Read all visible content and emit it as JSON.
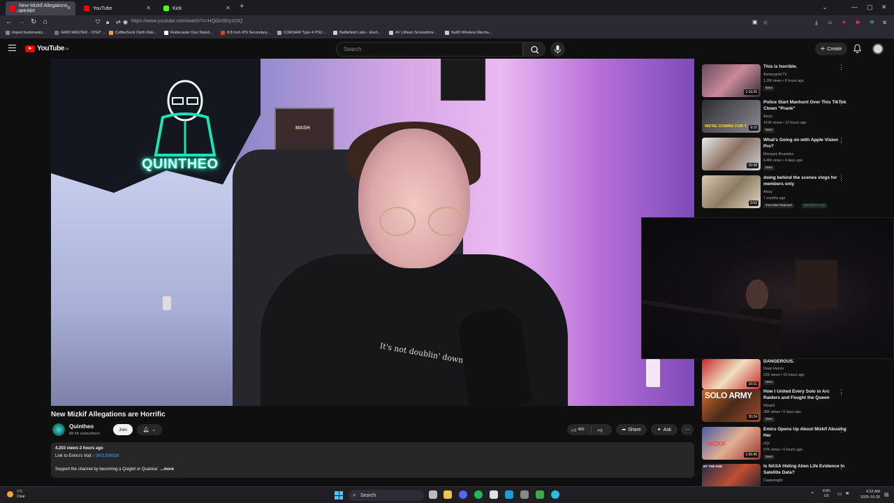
{
  "browser": {
    "tabs": [
      {
        "title": "New Mizkif Allegations are Hor",
        "subtitle": "PLAYING",
        "favicon_color": "#ff0000"
      },
      {
        "title": "YouTube",
        "favicon_color": "#ff0000"
      },
      {
        "title": "Kick",
        "favicon_color": "#53fc18"
      }
    ],
    "url": "https://www.youtube.com/watch?v=HQdzn9DyXOQ",
    "bookmarks": [
      {
        "label": "Import bookmarks...",
        "color": "#888888"
      },
      {
        "label": "GRID MASTER - STEP ...",
        "color": "#777777"
      },
      {
        "label": "CoffeeSock Cloth Disk...",
        "color": "#e5a93a"
      },
      {
        "label": "Rodecaster Duo Stand...",
        "color": "#ffffff"
      },
      {
        "label": "8.8 Inch IPS Secondary...",
        "color": "#e03c31"
      },
      {
        "label": "CORSAIR Type 4 PSU ...",
        "color": "#aaaaaa"
      },
      {
        "label": "Battlefield Labs - Elect...",
        "color": "#cccccc"
      },
      {
        "label": "4V Lithium Screwdrive...",
        "color": "#cccccc"
      },
      {
        "label": "Nu65 Wireless Mecha...",
        "color": "#cccccc"
      }
    ]
  },
  "youtube": {
    "logo": "YouTube",
    "country": "CA",
    "search_placeholder": "Search",
    "create_label": "Create"
  },
  "video": {
    "title": "New Mizkif Allegations are Horrific",
    "neon_sign_text": "QUINTHEO",
    "poster_text": "MASH",
    "shirt_text": "It's not doublin' down",
    "channel_name": "Quintheo",
    "channel_subs": "88.4K subscribers",
    "join_label": "Join",
    "like_count": "456",
    "share_label": "Share",
    "ask_label": "Ask",
    "description": {
      "meta": "4,203 views  2 hours ago",
      "link_prefix": "Link to Emiru's Vod:",
      "link_tag": "/ 2601308938",
      "body": "Support the channel by becoming a Quiglet or Quankar",
      "more": "...more"
    }
  },
  "sidebar": {
    "recommendations": [
      {
        "title": "This is horrible.",
        "channel": "Asmongold TV",
        "stats": "1.2M views • 8 hours ago",
        "badge": "New",
        "duration": "1:16:26",
        "thumb_color": "#6a4a5a"
      },
      {
        "title": "Police Start Manhunt Over This TikTok Clown \"Prank\"",
        "channel": "Atozy",
        "stats": "141K views • 12 hours ago",
        "badge": "New",
        "duration": "9:10",
        "thumb_color": "#2d2d33",
        "thumb_text": "WE'RE COMING FOR Y"
      },
      {
        "title": "What's Going on with Apple Vision Pro?",
        "channel": "Marques Brownlee",
        "stats": "4.4M views • 4 days ago",
        "badge": "New",
        "duration": "10:38",
        "thumb_color": "#e8e8ec"
      },
      {
        "title": "doing behind the scenes vlogs for members only",
        "channel": "Atozy",
        "stats": "7 months ago",
        "badge": "YouTube featured",
        "badge2": "Members only",
        "duration": "0:52",
        "thumb_color": "#b9a890"
      },
      {
        "title": "DANGEROUS.",
        "channel": "Deep Humor",
        "stats": "22K views • 15 hours ago",
        "badge": "New",
        "duration": "10:21",
        "thumb_color": "#c8282a"
      },
      {
        "title": "How I United Every Solo in Arc Raiders and Fought the Queen",
        "channel": "Wizard",
        "stats": "35K views • 5 days ago",
        "badge": "New",
        "duration": "20:24",
        "thumb_color": "#a04a2a",
        "thumb_text": "SOLO ARMY"
      },
      {
        "title": "Emiru Opens Up About Mizkif Abusing Her",
        "channel": "xQc",
        "stats": "97K views • 6 hours ago",
        "badge": "New",
        "duration": "1:56:45",
        "thumb_color": "#4a5aa8",
        "thumb_text": "MIZKIF"
      },
      {
        "title": "Is NASA Hiding Alien Life Evidence in Satellite Data?",
        "channel": "Caspersight",
        "stats": "",
        "badge": "",
        "duration": "",
        "thumb_color": "#202a4a",
        "thumb_text": "BY THE END"
      }
    ]
  },
  "taskbar": {
    "weather_temp": "1°C",
    "weather_desc": "Clear",
    "search_label": "Search",
    "lang_top": "ENG",
    "lang_bottom": "US",
    "time": "4:32 AM",
    "date": "2025-10-26"
  }
}
